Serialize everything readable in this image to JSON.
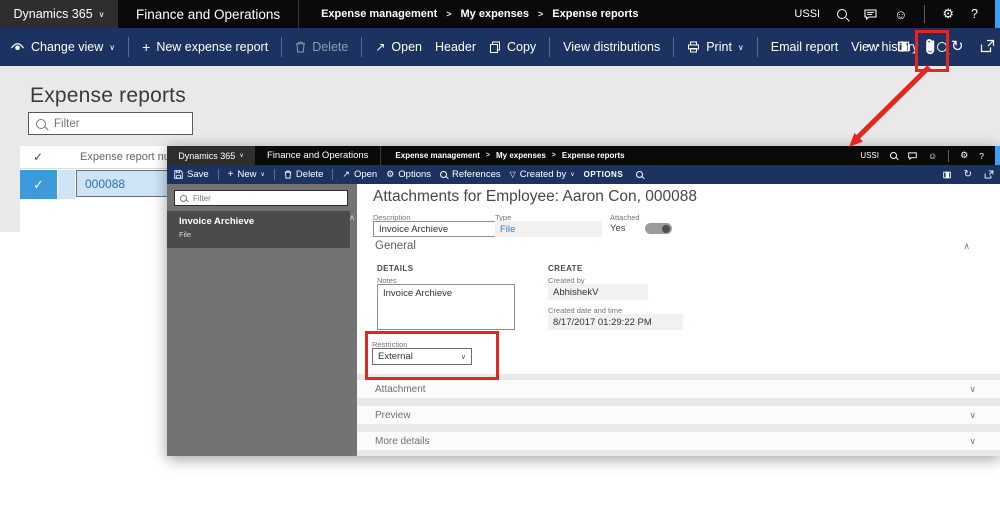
{
  "glyphs": {
    "chevron_down": "∨",
    "chevron_up": "∧",
    "plus": "+",
    "open_arrow": "↗",
    "check": "✓",
    "ellipsis": "⋯",
    "question": "?",
    "separator": ">",
    "funnel": "▽",
    "gear": "⚙",
    "smiley": "☺",
    "refresh": "↻"
  },
  "colors": {
    "annotation_red": "#e3261f",
    "action_bar_navy": "#1c3361",
    "top_bar_black": "#0a0a0a",
    "selected_row_blue": "#3d9bdc",
    "selected_row_light": "#cfe4f6",
    "link_blue": "#2e7dc3",
    "sidebar_gray": "#737373",
    "sidebar_selected_gray": "#4b4b4b"
  },
  "outer": {
    "topbar": {
      "app": "Dynamics 365",
      "product": "Finance and Operations",
      "breadcrumb": [
        "Expense management",
        "My expenses",
        "Expense reports"
      ],
      "company": "USSI"
    },
    "actionbar": {
      "change_view": "Change view",
      "new_expense_report": "New expense report",
      "delete": "Delete",
      "open": "Open",
      "header": "Header",
      "copy": "Copy",
      "view_distributions": "View distributions",
      "print": "Print",
      "email_report": "Email report",
      "view_history": "View history"
    },
    "page": {
      "title": "Expense reports",
      "filter_placeholder": "Filter",
      "column_header": "Expense report number",
      "row_value": "000088"
    }
  },
  "inner": {
    "topbar": {
      "app": "Dynamics 365",
      "product": "Finance and Operations",
      "breadcrumb": [
        "Expense management",
        "My expenses",
        "Expense reports"
      ],
      "company": "USSI"
    },
    "actionbar": {
      "save": "Save",
      "new": "New",
      "delete": "Delete",
      "open": "Open",
      "options": "Options",
      "references": "References",
      "created_by": "Created by",
      "options_tab": "OPTIONS"
    },
    "sidebar": {
      "filter_placeholder": "Filter",
      "item_title": "Invoice Archieve",
      "item_subtitle": "File"
    },
    "main": {
      "heading": "Attachments for Employee: Aaron Con, 000088",
      "description_label": "Description",
      "description_value": "Invoice Archieve",
      "type_label": "Type",
      "type_value": "File",
      "attached_label": "Attached",
      "attached_value": "Yes"
    },
    "general": {
      "title": "General",
      "details_header": "DETAILS",
      "notes_label": "Notes",
      "notes_value": "Invoice Archieve",
      "restriction_label": "Restriction",
      "restriction_value": "External",
      "create_header": "CREATE",
      "created_by_label": "Created by",
      "created_by_value": "AbhishekV",
      "created_datetime_label": "Created date and time",
      "created_datetime_value": "8/17/2017 01:29:22 PM"
    },
    "sections": [
      {
        "title": "Attachment"
      },
      {
        "title": "Preview"
      },
      {
        "title": "More details"
      }
    ]
  }
}
